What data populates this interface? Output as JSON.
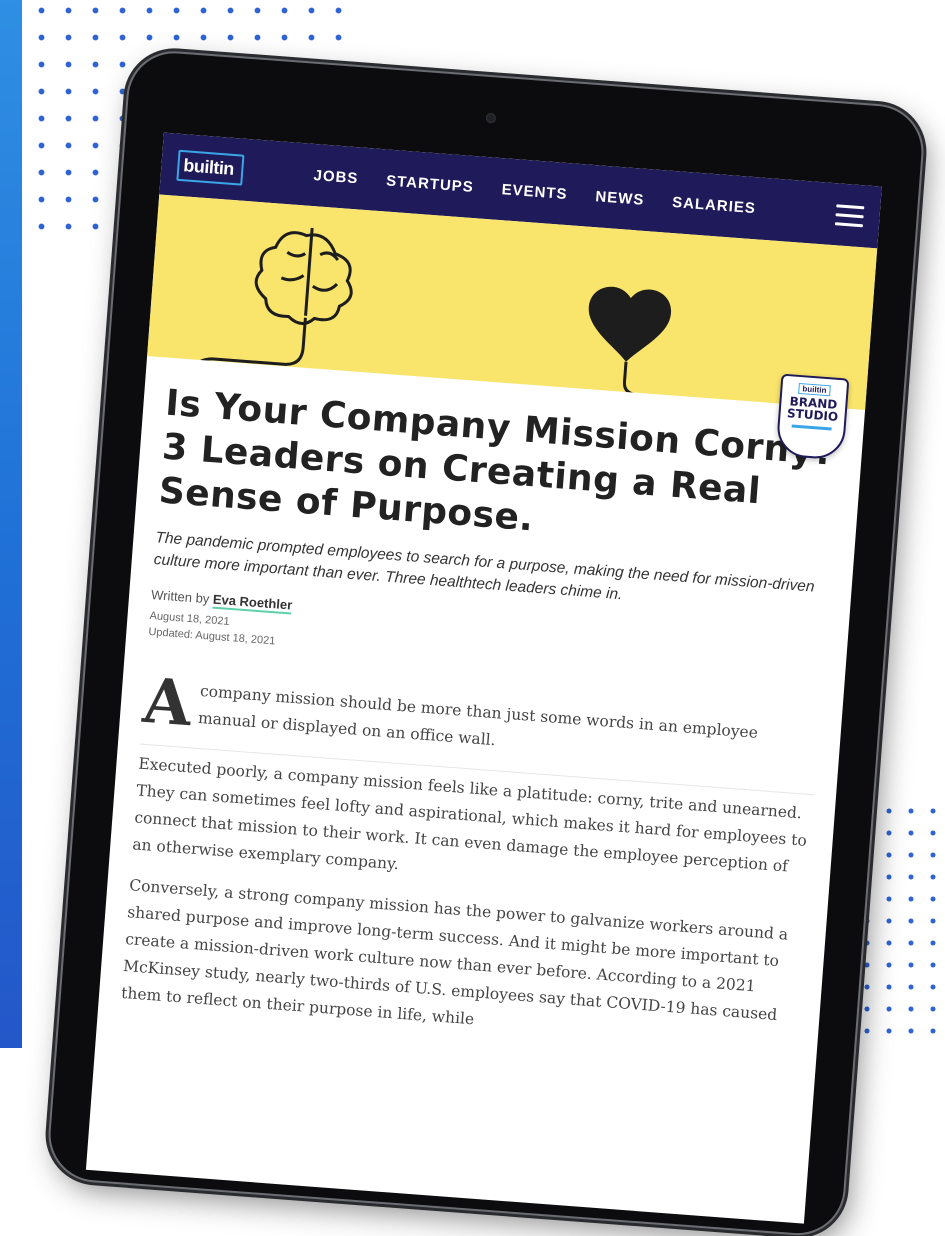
{
  "nav": {
    "logo": "builtin",
    "links": [
      "JOBS",
      "STARTUPS",
      "EVENTS",
      "NEWS",
      "SALARIES"
    ]
  },
  "badge": {
    "logo": "builtin",
    "line1": "BRAND",
    "line2": "STUDIO"
  },
  "article": {
    "title": "Is Your Company Mission Corny? 3 Leaders on Creating a Real Sense of Purpose.",
    "subtitle": "The pandemic prompted employees to search for a purpose, making the need for mission-driven culture more important than ever. Three healthtech leaders chime in.",
    "written_by_label": "Written by",
    "author": "Eva Roethler",
    "date": "August 18, 2021",
    "updated": "Updated: August 18, 2021",
    "dropcap": "A",
    "lead_text": "company mission should be more than just some words in an employee manual or displayed on an office wall.",
    "paragraph1": "Executed poorly, a company mission feels like a platitude: corny, trite and unearned. They can sometimes feel lofty and aspirational, which makes it hard for employees to connect that mission to their work. It can even damage the employee perception of an otherwise exemplary company.",
    "paragraph2": "Conversely, a strong company mission has the power to galvanize workers around a shared purpose and improve long-term success. And it might be more important to create a mission-driven work culture now than ever before. According to a 2021 McKinsey study, nearly two-thirds of U.S. employees say that COVID-19 has caused them to reflect on their purpose in life, while"
  },
  "colors": {
    "nav_bg": "#1f1a59",
    "hero_bg": "#fae56c",
    "accent": "#3aa6e8",
    "page_dots": "#2f63d4"
  },
  "icons": [
    "brain-icon",
    "heart-icon",
    "menu-icon",
    "camera-icon"
  ]
}
